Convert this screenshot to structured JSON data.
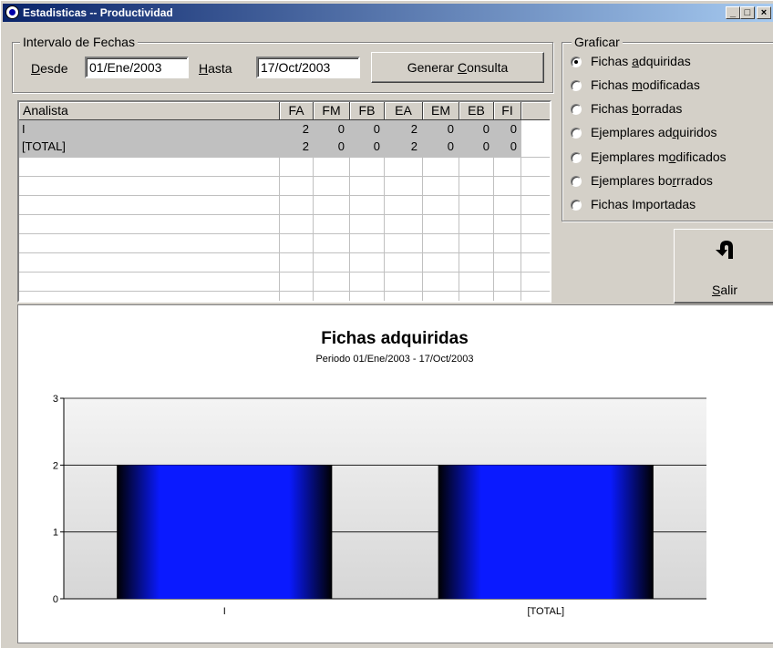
{
  "window": {
    "title": "Estadisticas -- Productividad",
    "buttons": {
      "minimize": "_",
      "maximize": "□",
      "close": "×"
    }
  },
  "dates": {
    "group_label": "Intervalo de Fechas",
    "desde_label_u": "D",
    "desde_label_rest": "esde",
    "desde_value": "01/Ene/2003",
    "hasta_label_u": "H",
    "hasta_label_rest": "asta",
    "hasta_value": "17/Oct/2003",
    "generate_pre": "Generar ",
    "generate_u": "C",
    "generate_post": "onsulta"
  },
  "table": {
    "columns": [
      "Analista",
      "FA",
      "FM",
      "FB",
      "EA",
      "EM",
      "EB",
      "FI"
    ],
    "rows": [
      [
        "I",
        "2",
        "0",
        "0",
        "2",
        "0",
        "0",
        "0"
      ],
      [
        "[TOTAL]",
        "2",
        "0",
        "0",
        "2",
        "0",
        "0",
        "0"
      ]
    ]
  },
  "graficar": {
    "group_label": "Graficar",
    "options": [
      {
        "pre": "Fichas ",
        "u": "a",
        "post": "dquiridas",
        "selected": true
      },
      {
        "pre": "Fichas ",
        "u": "m",
        "post": "odificadas",
        "selected": false
      },
      {
        "pre": "Fichas ",
        "u": "b",
        "post": "orradas",
        "selected": false
      },
      {
        "pre": "Ejemplares ad",
        "u": "q",
        "post": "uiridos",
        "selected": false
      },
      {
        "pre": "Ejemplares m",
        "u": "o",
        "post": "dificados",
        "selected": false
      },
      {
        "pre": "Ejemplares bo",
        "u": "r",
        "post": "rrados",
        "selected": false
      },
      {
        "pre": "Fichas Importadas",
        "u": "",
        "post": "",
        "selected": false
      }
    ]
  },
  "exit_button": {
    "u": "S",
    "rest": "alir",
    "icon": "u-turn-arrow-icon"
  },
  "chart_data": {
    "type": "bar",
    "title": "Fichas adquiridas",
    "subtitle": "Periodo 01/Ene/2003 - 17/Oct/2003",
    "categories": [
      "I",
      "[TOTAL]"
    ],
    "values": [
      2,
      2
    ],
    "ylim": [
      0,
      3
    ],
    "yticks": [
      "0",
      "1",
      "2",
      "3"
    ],
    "grid": true,
    "legend": "none",
    "bar_color": "#0a1aff",
    "bar_edge_color": "#000000"
  }
}
